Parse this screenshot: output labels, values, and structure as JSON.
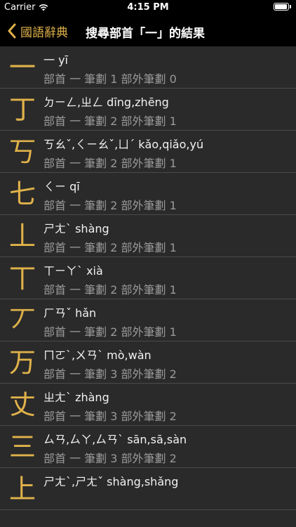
{
  "status": {
    "carrier": "Carrier",
    "time": "4:15 PM"
  },
  "nav": {
    "back_label": "國語辭典",
    "title": "搜尋部首「一」的結果"
  },
  "rows": [
    {
      "char": "一",
      "pron": "一 yī",
      "info": "部首 一 筆劃 1 部外筆劃 0"
    },
    {
      "char": "丁",
      "pron": "ㄉㄧㄥ,ㄓㄥ dīng,zhēng",
      "info": "部首 一 筆劃 2 部外筆劃 1"
    },
    {
      "char": "丂",
      "pron": "ㄎㄠˇ,ㄑㄧㄠˇ,ㄩˊ kǎo,qiǎo,yú",
      "info": "部首 一 筆劃 2 部外筆劃 1"
    },
    {
      "char": "七",
      "pron": "ㄑㄧ qī",
      "info": "部首 一 筆劃 2 部外筆劃 1"
    },
    {
      "char": "丄",
      "pron": "ㄕㄤˋ shàng",
      "info": "部首 一 筆劃 2 部外筆劃 1"
    },
    {
      "char": "丅",
      "pron": "ㄒㄧㄚˋ xià",
      "info": "部首 一 筆劃 2 部外筆劃 1"
    },
    {
      "char": "丆",
      "pron": "ㄏㄢˇ hǎn",
      "info": "部首 一 筆劃 2 部外筆劃 1"
    },
    {
      "char": "万",
      "pron": "ㄇㄛˋ,ㄨㄢˋ mò,wàn",
      "info": "部首 一 筆劃 3 部外筆劃 2"
    },
    {
      "char": "丈",
      "pron": "ㄓㄤˋ zhàng",
      "info": "部首 一 筆劃 3 部外筆劃 2"
    },
    {
      "char": "三",
      "pron": "ㄙㄢ,ㄙㄚ,ㄙㄢˋ sān,sā,sàn",
      "info": "部首 一 筆劃 3 部外筆劃 2"
    },
    {
      "char": "上",
      "pron": "ㄕㄤˋ,ㄕㄤˇ shàng,shǎng",
      "info": ""
    }
  ]
}
